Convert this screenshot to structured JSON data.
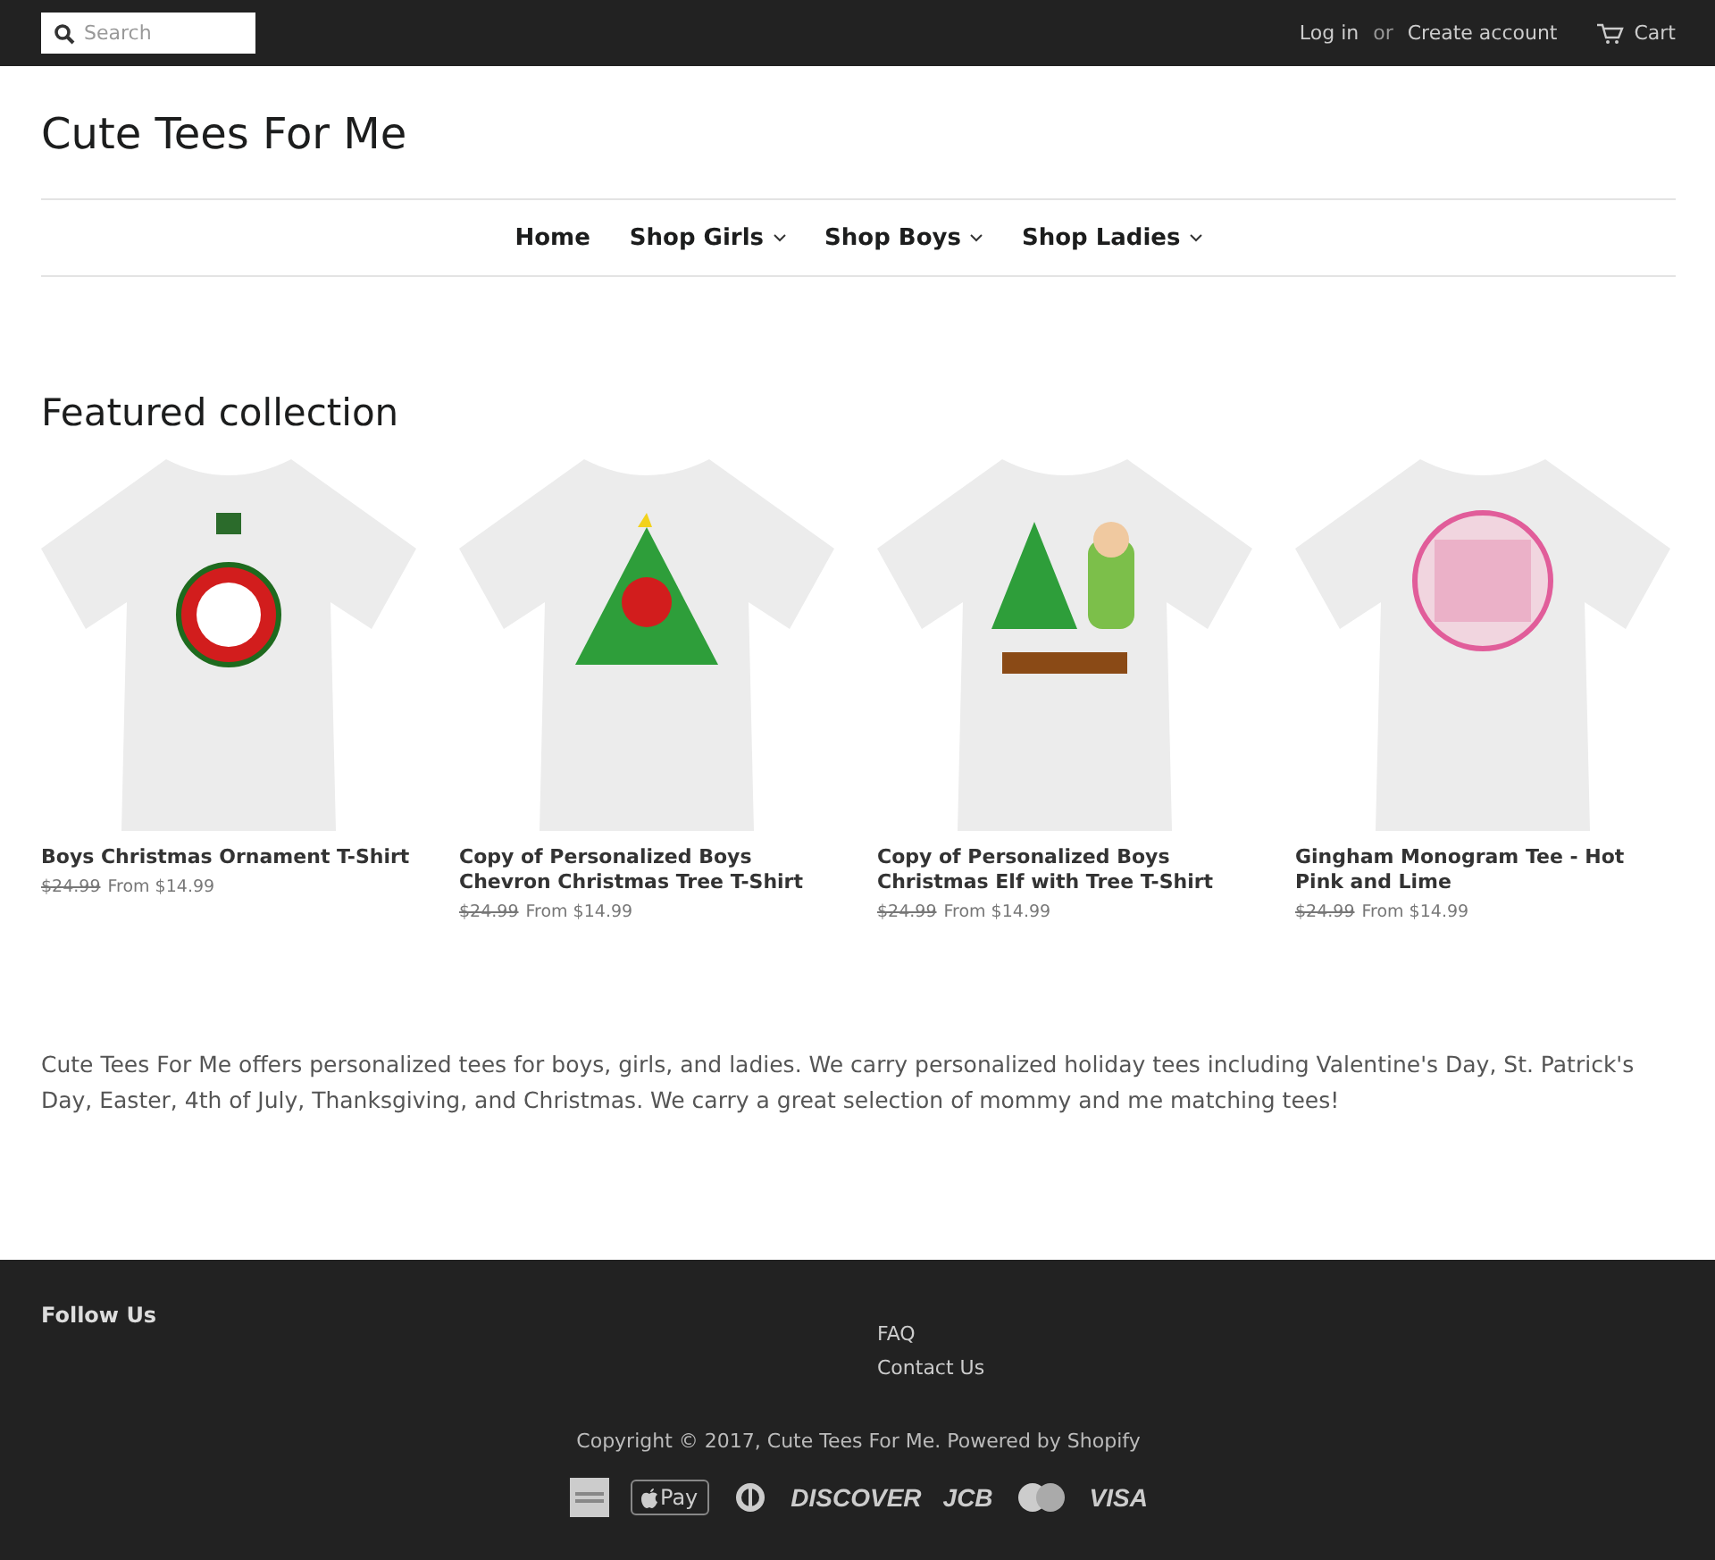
{
  "top_bar": {
    "search": {
      "placeholder": "Search"
    },
    "login": "Log in",
    "separator": "or",
    "create_account": "Create account",
    "cart": "Cart"
  },
  "site_title": "Cute Tees For Me",
  "nav": [
    {
      "label": "Home",
      "dropdown": false
    },
    {
      "label": "Shop Girls",
      "dropdown": true
    },
    {
      "label": "Shop Boys",
      "dropdown": true
    },
    {
      "label": "Shop Ladies",
      "dropdown": true
    }
  ],
  "featured": {
    "heading": "Featured collection",
    "products": [
      {
        "title": "Boys Christmas Ornament T-Shirt",
        "old_price": "$24.99",
        "price": "From $14.99",
        "kind": "ornament"
      },
      {
        "title": "Copy of Personalized Boys Chevron Christmas Tree T-Shirt",
        "old_price": "$24.99",
        "price": "From $14.99",
        "kind": "tree"
      },
      {
        "title": "Copy of Personalized Boys Christmas Elf with Tree T-Shirt",
        "old_price": "$24.99",
        "price": "From $14.99",
        "kind": "elf"
      },
      {
        "title": "Gingham Monogram Tee - Hot Pink and Lime",
        "old_price": "$24.99",
        "price": "From $14.99",
        "kind": "monogram"
      }
    ]
  },
  "about": "Cute Tees For Me offers personalized tees for boys, girls, and ladies.  We carry personalized holiday tees including Valentine's Day, St. Patrick's Day, Easter, 4th of July, Thanksgiving, and Christmas.  We carry a great selection of mommy and me matching tees!",
  "footer": {
    "follow_heading": "Follow Us",
    "links": [
      "FAQ",
      "Contact Us"
    ],
    "copyright": "Copyright © 2017, Cute Tees For Me. Powered by Shopify",
    "payments": [
      {
        "kind": "amex"
      },
      {
        "kind": "applepay",
        "label": "Pay"
      },
      {
        "kind": "diners"
      },
      {
        "kind": "text",
        "label": "DISCOVER"
      },
      {
        "kind": "text",
        "label": "JCB"
      },
      {
        "kind": "mastercard"
      },
      {
        "kind": "text",
        "label": "VISA"
      }
    ]
  }
}
